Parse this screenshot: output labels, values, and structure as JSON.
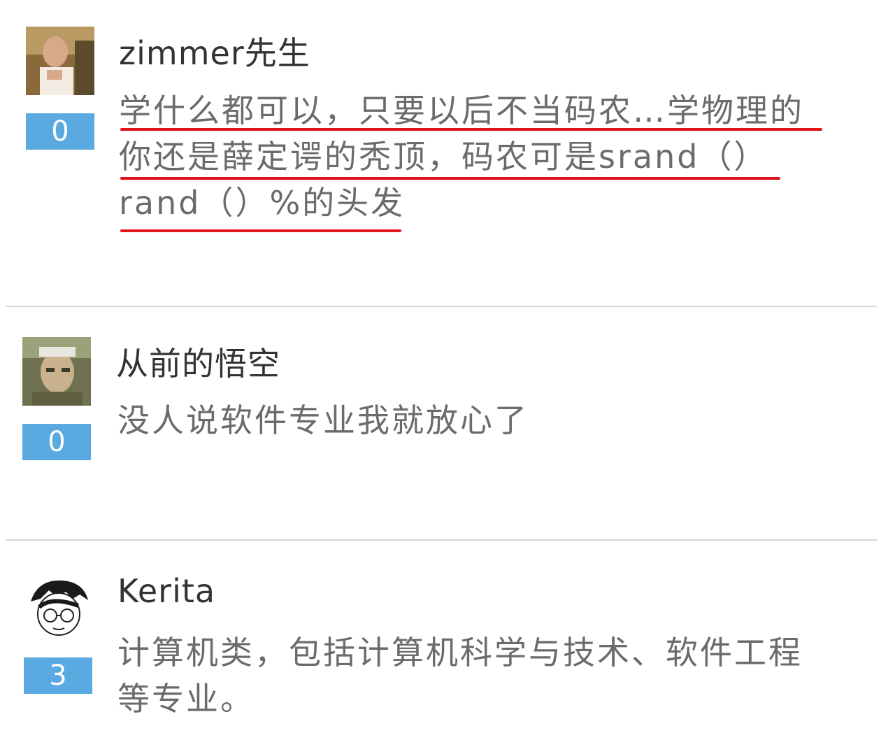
{
  "comments": [
    {
      "username": "zimmer先生",
      "votes": "0",
      "lines": [
        "学什么都可以，只要以后不当码农…学物理的",
        "你还是薛定谔的秃顶，码农可是srand（）",
        "rand（）%的头发"
      ],
      "avatar_icon": "user-avatar-icon",
      "underline_color": "#e0141a"
    },
    {
      "username": "从前的悟空",
      "votes": "0",
      "lines": [
        "没人说软件专业我就放心了"
      ],
      "avatar_icon": "user-avatar-icon"
    },
    {
      "username": "Kerita",
      "votes": "3",
      "lines": [
        "计算机类，包括计算机科学与技术、软件工程",
        "等专业。"
      ],
      "avatar_icon": "user-avatar-icon"
    }
  ],
  "colors": {
    "vote_badge": "#5aa9e0",
    "username": "#333333",
    "body_text": "#6b6b6b",
    "divider": "#d6d6d6"
  }
}
